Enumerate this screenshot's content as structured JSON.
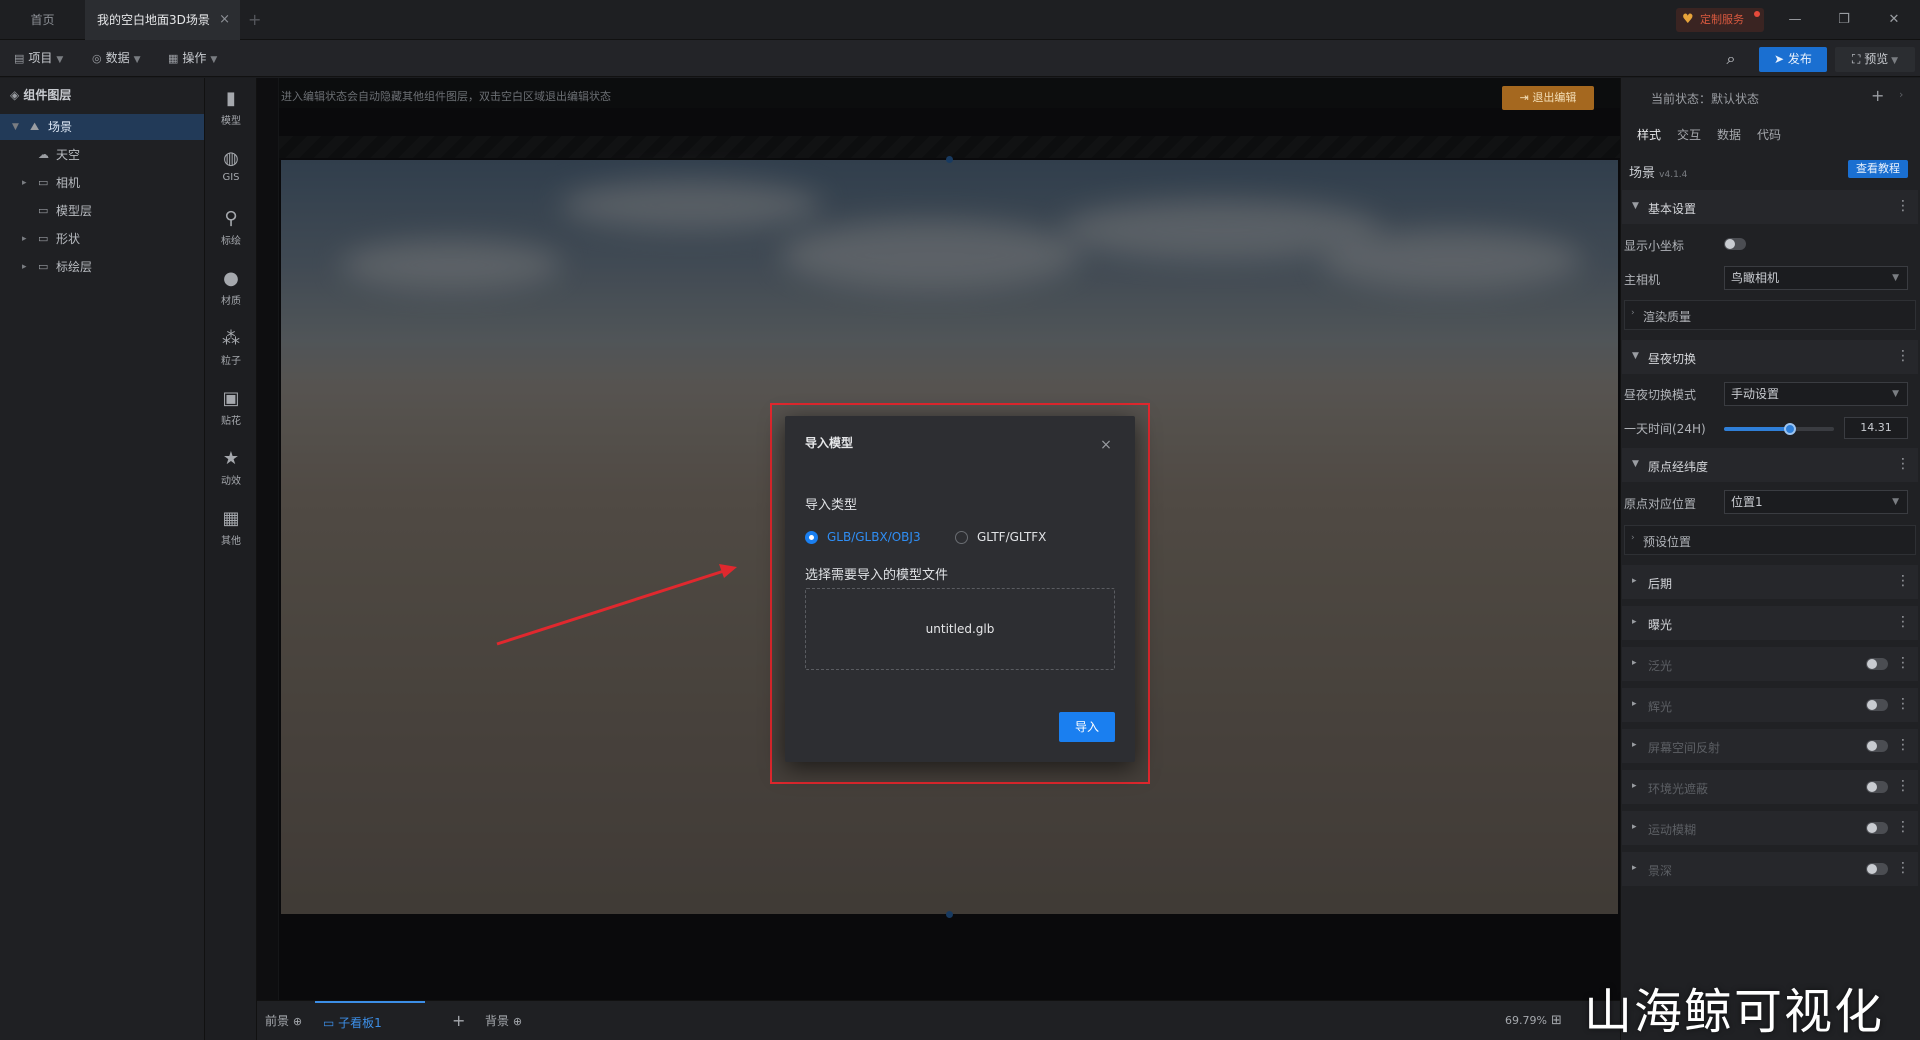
{
  "tabs": {
    "home": "首页",
    "active": "我的空白地面3D场景",
    "close": "×",
    "add": "+"
  },
  "header": {
    "service_badge": "定制服务",
    "publish": "发布",
    "preview": "预览",
    "win_min": "—",
    "win_restore": "❐",
    "win_close": "✕"
  },
  "menu": {
    "project": "项目",
    "data": "数据",
    "operate": "操作"
  },
  "layers": {
    "title": "组件图层",
    "items": [
      "场景",
      "天空",
      "相机",
      "模型层",
      "形状",
      "标绘层"
    ]
  },
  "components": [
    "模型",
    "GIS",
    "标绘",
    "材质",
    "粒子",
    "贴花",
    "动效",
    "其他"
  ],
  "stage": {
    "hint": "进入编辑状态会自动隐藏其他组件图层，双击空白区域退出编辑状态",
    "exit_edit": "退出编辑"
  },
  "stagebar": {
    "front": "前景",
    "child_page": "子看板1",
    "add": "+",
    "background": "背景",
    "zoom": "69.79%"
  },
  "props": {
    "current_state_label": "当前状态：默认状态",
    "add": "+",
    "tabs": [
      "样式",
      "交互",
      "数据",
      "代码"
    ],
    "scene_title": "场景",
    "version": "v4.1.4",
    "tutorial": "查看教程",
    "basic_settings": "基本设置",
    "show_axis": "显示小坐标",
    "main_camera": "主相机",
    "main_camera_value": "鸟瞰相机",
    "render_quality": "渲染质量",
    "day_night": "昼夜切换",
    "day_night_mode": "昼夜切换模式",
    "day_night_mode_value": "手动设置",
    "day_time": "一天时间(24H)",
    "day_time_value": "14.31",
    "day_time_fraction": 0.6,
    "origin": "原点经纬度",
    "origin_position": "原点对应位置",
    "origin_position_value": "位置1",
    "preset_position": "预设位置",
    "post": "后期",
    "exposure": "曝光",
    "bloom": "泛光",
    "glow": "辉光",
    "ssr": "屏幕空间反射",
    "ao": "环境光遮蔽",
    "motion_blur": "运动模糊",
    "dof": "景深"
  },
  "modal": {
    "title": "导入模型",
    "close": "×",
    "type_label": "导入类型",
    "option_glb": "GLB/GLBX/OBJ3",
    "option_gltf": "GLTF/GLTFX",
    "selected": "GLB/GLBX/OBJ3",
    "file_label": "选择需要导入的模型文件",
    "file_name": "untitled.glb",
    "import_button": "导入"
  },
  "watermark": "山海鲸可视化",
  "colors": {
    "accent": "#1a7ff0",
    "highlight_box": "#e0282e",
    "exit_edit": "#a5681f"
  }
}
